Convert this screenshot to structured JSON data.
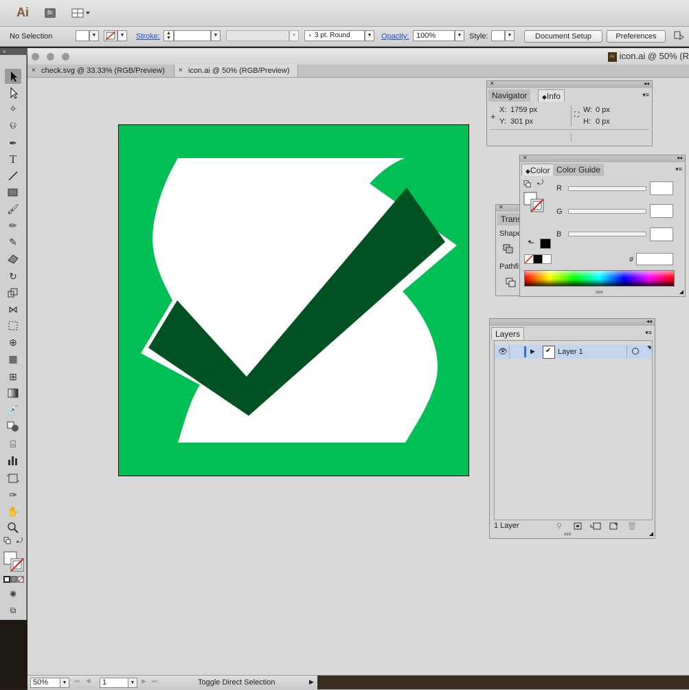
{
  "app": {
    "logo": "Ai",
    "bridge": "Br"
  },
  "control_bar": {
    "selection_state": "No Selection",
    "stroke_label": "Stroke:",
    "brush_value": "3 pt. Round",
    "opacity_label": "Opacity:",
    "opacity_value": "100%",
    "style_label": "Style:",
    "document_setup": "Document Setup",
    "preferences": "Preferences"
  },
  "window": {
    "title": "icon.ai @ 50% (R"
  },
  "tabs": [
    {
      "label": "check.svg @ 33.33% (RGB/Preview)",
      "close": "×"
    },
    {
      "label": "icon.ai @ 50% (RGB/Preview)",
      "close": "×"
    }
  ],
  "artwork": {
    "background_color": "#00bf55",
    "mark_light_color": "#ffffff",
    "check_color": "#005222"
  },
  "navigator_panel": {
    "tabs": [
      "Navigator",
      "Info"
    ],
    "x_label": "X:",
    "x_value": "1759 px",
    "y_label": "Y:",
    "y_value": "301 px",
    "w_label": "W:",
    "w_value": "0 px",
    "h_label": "H:",
    "h_value": "0 px"
  },
  "transform_panel": {
    "tab": "Trans",
    "shape_label": "Shape",
    "pathfinder_label": "Pathfi"
  },
  "color_panel": {
    "tabs": [
      "Color",
      "Color Guide"
    ],
    "r_label": "R",
    "g_label": "G",
    "b_label": "B",
    "hex_label": "#"
  },
  "layers_panel": {
    "tab": "Layers",
    "layer_name": "Layer 1",
    "count": "1 Layer"
  },
  "status_bar": {
    "zoom": "50%",
    "artboard": "1",
    "tool_status": "Toggle Direct Selection"
  }
}
